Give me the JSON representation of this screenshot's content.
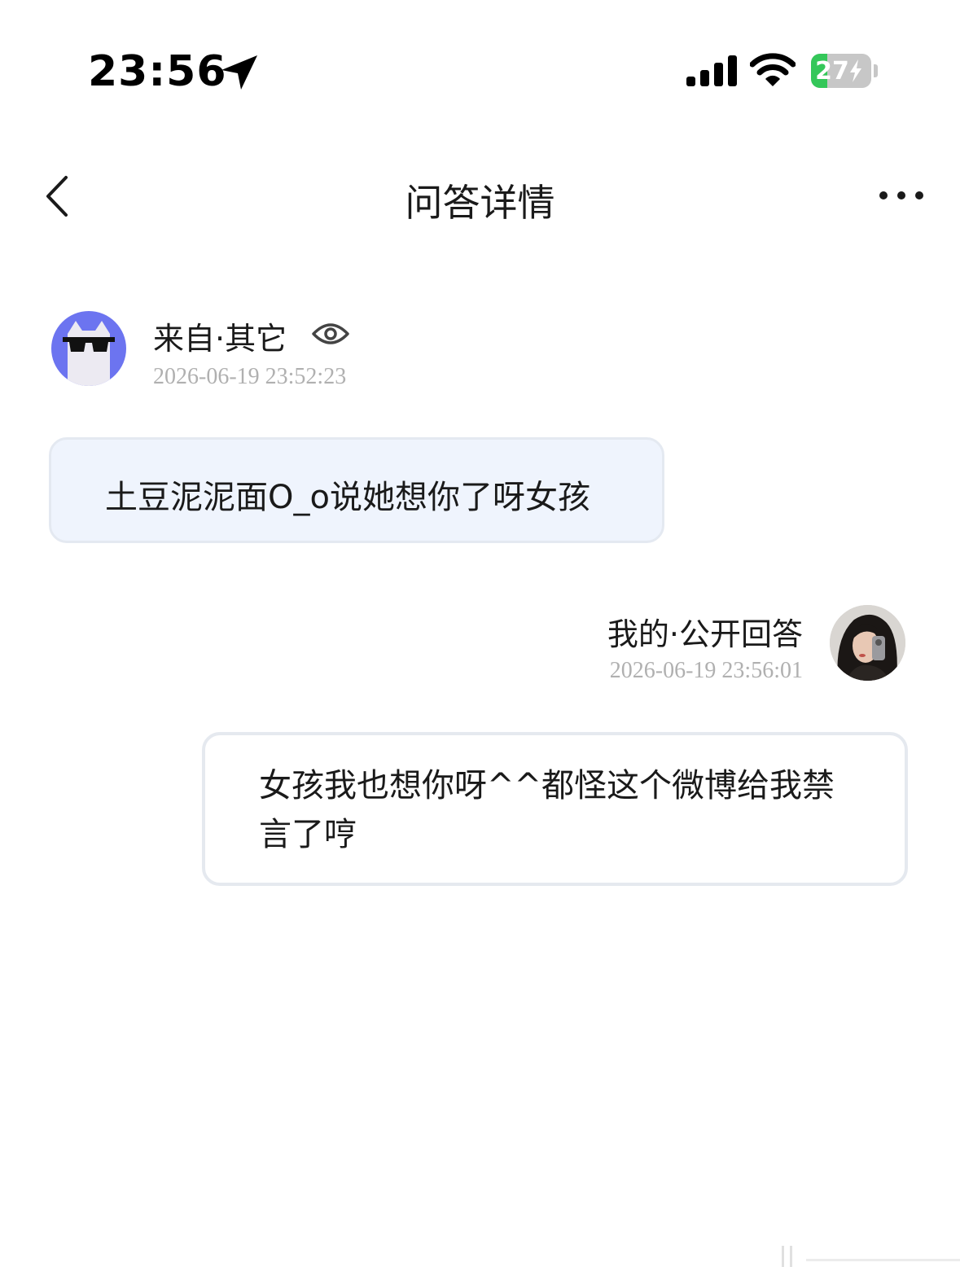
{
  "status_bar": {
    "time": "23:56",
    "battery_percent": 27,
    "battery_label": "27",
    "icons": [
      "location-arrow-icon",
      "cellular-signal-icon",
      "wifi-icon",
      "battery-charging-icon"
    ]
  },
  "nav": {
    "title": "问答详情",
    "back_icon": "chevron-left-icon",
    "more_icon": "more-horizontal-icon"
  },
  "question": {
    "source_label": "来自·其它",
    "visibility_icon": "eye-icon",
    "timestamp": "2026-06-19 23:52:23",
    "text": "土豆泥泥面O_o说她想你了呀女孩",
    "avatar": "cat-sunglasses-avatar",
    "avatar_bg": "#6c74f0"
  },
  "answer": {
    "source_label": "我的·公开回答",
    "timestamp": "2026-06-19 23:56:01",
    "text": "女孩我也想你呀^^都怪这个微博给我禁言了哼",
    "avatar": "user-photo-avatar"
  },
  "colors": {
    "question_bubble_bg": "#eff4fd",
    "bubble_border": "#e5e9ef",
    "timestamp": "#b0b0b0",
    "battery_green": "#34c759"
  }
}
